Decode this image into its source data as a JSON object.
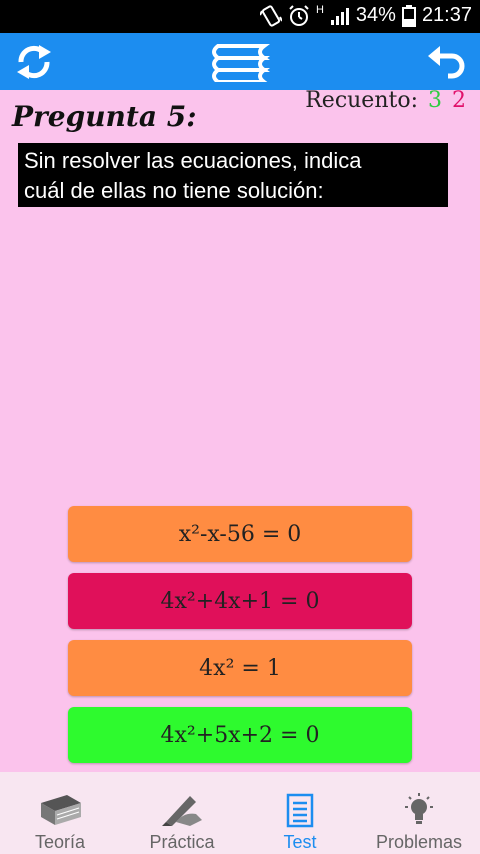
{
  "status_bar": {
    "network": "H",
    "battery": "34%",
    "time": "21:37"
  },
  "app_bar": {
    "icons": [
      "refresh-icon",
      "book-stack-icon",
      "back-arrow-icon"
    ]
  },
  "question": {
    "title": "Pregunta 5:",
    "text_line1": "Sin resolver las ecuaciones, indica",
    "text_line2": "cuál de ellas no tiene solución:"
  },
  "counter": {
    "label": "Recuento:",
    "correct": "3",
    "wrong": "2",
    "correct_color": "#2ecc40",
    "wrong_color": "#e0106a"
  },
  "answers": [
    {
      "text": "x²-x-56 = 0",
      "color": "#ff8c42"
    },
    {
      "text": "4x²+4x+1 = 0",
      "color": "#e0105a"
    },
    {
      "text": "4x² = 1",
      "color": "#ff8c42"
    },
    {
      "text": "4x²+5x+2 = 0",
      "color": "#2efa2e"
    }
  ],
  "bottom_nav": {
    "items": [
      {
        "label": "Teoría",
        "icon": "book-icon"
      },
      {
        "label": "Práctica",
        "icon": "pencil-hand-icon"
      },
      {
        "label": "Test",
        "icon": "notepad-icon",
        "active": true
      },
      {
        "label": "Problemas",
        "icon": "lightbulb-icon"
      }
    ],
    "active_color": "#1c8df0"
  }
}
